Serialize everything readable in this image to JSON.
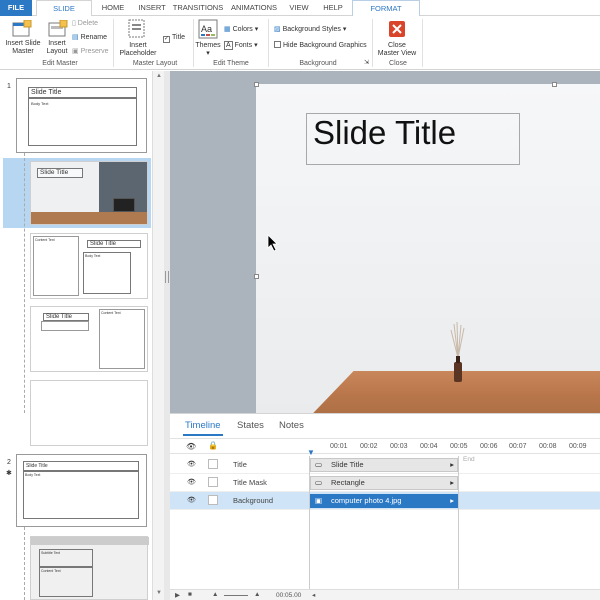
{
  "ribbon_tabs": [
    {
      "label": "FILE"
    },
    {
      "label": "SLIDE MASTER"
    },
    {
      "label": "HOME"
    },
    {
      "label": "INSERT"
    },
    {
      "label": "TRANSITIONS"
    },
    {
      "label": "ANIMATIONS"
    },
    {
      "label": "VIEW"
    },
    {
      "label": "HELP"
    },
    {
      "label": "FORMAT"
    }
  ],
  "edit_master": {
    "group_label": "Edit Master",
    "insert_slide_master": "Insert Slide\nMaster",
    "insert_layout": "Insert\nLayout",
    "delete": "Delete",
    "rename": "Rename",
    "preserve": "Preserve"
  },
  "master_layout": {
    "group_label": "Master Layout",
    "insert_placeholder": "Insert\nPlaceholder",
    "title_check": "Title"
  },
  "edit_theme": {
    "group_label": "Edit Theme",
    "themes": "Themes",
    "colors": "Colors",
    "fonts": "Fonts"
  },
  "background": {
    "group_label": "Background",
    "background_styles": "Background Styles",
    "hide_background_graphics": "Hide Background Graphics"
  },
  "close": {
    "group_label": "Close",
    "close_master_view": "Close\nMaster View"
  },
  "thumbnails": {
    "slide1_num": "1",
    "slide2_num": "2",
    "title_label": "Slide Title",
    "text_label": "Body Text",
    "subtitle_label": "Subtitle Text",
    "content_label": "Content Text"
  },
  "slide": {
    "title": "Slide Title"
  },
  "timeline": {
    "tabs": [
      "Timeline",
      "States",
      "Notes"
    ],
    "ticks": [
      "00:01",
      "00:02",
      "00:03",
      "00:04",
      "00:05",
      "00:06",
      "00:07",
      "00:08",
      "00:09"
    ],
    "end_label": "End",
    "rows": [
      {
        "name": "Title",
        "bar": "Slide Title"
      },
      {
        "name": "Title Mask",
        "bar": "Rectangle"
      },
      {
        "name": "Background",
        "bar": "computer photo 4.jpg"
      }
    ],
    "duration": "00:05.00"
  },
  "colors": {
    "accent": "#2b78c5",
    "selected_row": "#cfe4f7",
    "canvas_bg": "#abb4bc"
  }
}
